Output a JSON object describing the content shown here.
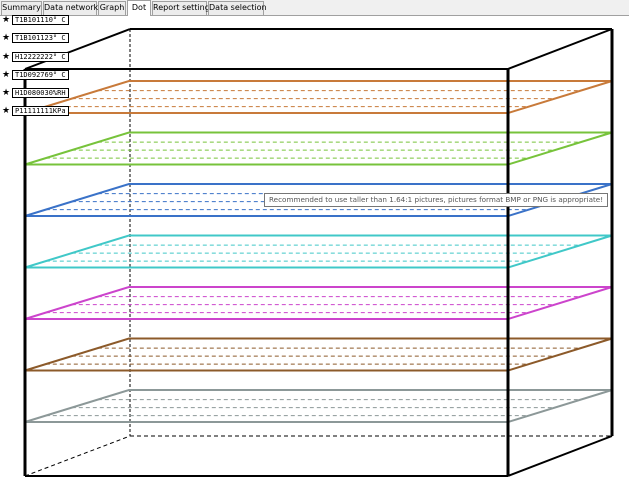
{
  "tabs": [
    {
      "label": "Summary",
      "active": false
    },
    {
      "label": "Data network",
      "active": false
    },
    {
      "label": "Graph",
      "active": false
    },
    {
      "label": "Dot",
      "active": true
    },
    {
      "label": "Report setting",
      "active": false
    },
    {
      "label": "Data selection",
      "active": false
    }
  ],
  "sensors": [
    {
      "label": "T1B101110° C"
    },
    {
      "label": "T1B101123° C"
    },
    {
      "label": "H12222222° C"
    },
    {
      "label": "T1D092769° C"
    },
    {
      "label": "H1D080030%RH"
    },
    {
      "label": "P11111111KPa"
    }
  ],
  "layer_colors": [
    "#c87a3a",
    "#77c33b",
    "#3a72c8",
    "#40c8c8",
    "#cc44cc",
    "#8c5a2a",
    "#8c9898"
  ],
  "tooltip": "Recommended to use taller than 1.64:1 pictures, pictures format BMP or PNG is appropriate!"
}
